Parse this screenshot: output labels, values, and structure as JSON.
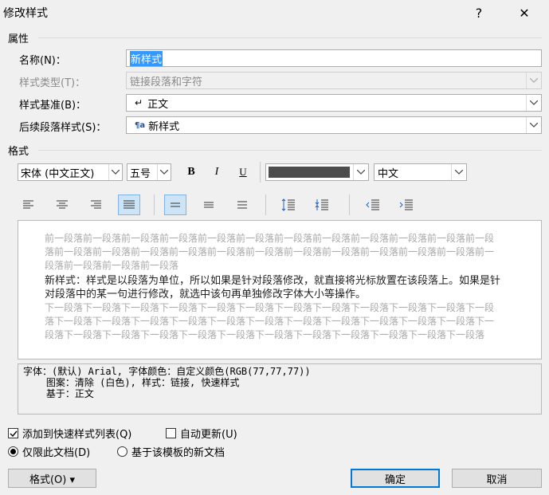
{
  "dialog": {
    "title": "修改样式",
    "help": "?",
    "close": "✕"
  },
  "properties": {
    "section_label": "属性",
    "name_label": "名称(N)：",
    "name_value": "新样式",
    "type_label": "样式类型(T)：",
    "type_value": "链接段落和字符",
    "based_label": "样式基准(B)：",
    "based_value": "正文",
    "next_label": "后续段落样式(S)：",
    "next_value": "新样式"
  },
  "format": {
    "section_label": "格式",
    "font": "宋体 (中文正文)",
    "size": "五号",
    "bold": "B",
    "italic": "I",
    "underline": "U",
    "language": "中文",
    "color": "#4d4d4d"
  },
  "preview": {
    "before": "前一段落前一段落前一段落前一段落前一段落前一段落前一段落前一段落前一段落前一段落前一段落前一段落前一段落前一段落前一段落前一段落前一段落前一段落前一段落前一段落前一段落前一段落前一段落前一段落前一段落前一段落前一段落",
    "main": "新样式：样式是以段落为单位，所以如果是针对段落修改，就直接将光标放置在该段落上。如果是针对段落中的某一句进行修改，就选中该句再单独修改字体大小等操作。",
    "after": "下一段落下一段落下一段落下一段落下一段落下一段落下一段落下一段落下一段落下一段落下一段落下一段落下一段落下一段落下一段落下一段落下一段落下一段落下一段落下一段落下一段落下一段落下一段落下一段落下一段落下一段落下一段落下一段落下一段落下一段落下一段落下一段落下一段落下一段落下一段落"
  },
  "description": {
    "line1": "字体：(默认) Arial, 字体颜色：自定义颜色(RGB(77,77,77))",
    "line2": "    图案：清除 (白色), 样式：链接, 快速样式",
    "line3": "    基于：正文"
  },
  "options": {
    "add_quick": "添加到快速样式列表(Q)",
    "add_quick_checked": true,
    "auto_update": "自动更新(U)",
    "auto_update_checked": false,
    "only_doc": "仅限此文档(D)",
    "new_docs": "基于该模板的新文档",
    "selected": "only_doc"
  },
  "buttons": {
    "format": "格式(O) ▾",
    "ok": "确定",
    "cancel": "取消"
  }
}
